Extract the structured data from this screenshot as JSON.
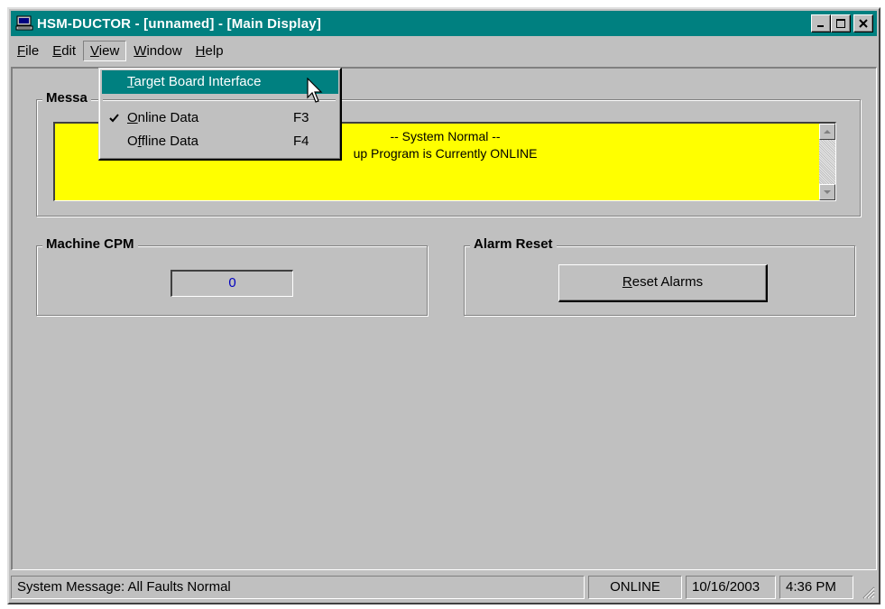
{
  "window": {
    "title": "HSM-DUCTOR - [unnamed] - [Main Display]",
    "title_buttons": [
      "minimize",
      "maximize",
      "close"
    ]
  },
  "menubar": {
    "items": [
      {
        "label": "File",
        "accel": "F",
        "rest": "ile"
      },
      {
        "label": "Edit",
        "accel": "E",
        "rest": "dit"
      },
      {
        "label": "View",
        "accel": "V",
        "rest": "iew",
        "open": true
      },
      {
        "label": "Window",
        "accel": "W",
        "rest": "indow"
      },
      {
        "label": "Help",
        "accel": "H",
        "rest": "elp"
      }
    ]
  },
  "view_menu": {
    "items": [
      {
        "label": "Target Board Interface",
        "accel": "T",
        "rest": "arget Board Interface",
        "shortcut": "",
        "checked": false,
        "highlighted": true
      },
      {
        "label": "Online Data",
        "accel": "O",
        "pre": "",
        "rest": "nline Data",
        "shortcut": "F3",
        "checked": true
      },
      {
        "label": "Offline Data",
        "accel": "f",
        "pre": "O",
        "rest": "fline Data",
        "shortcut": "F4",
        "checked": false
      }
    ]
  },
  "messages": {
    "group_label": "Messa",
    "line1": "-- System Normal --",
    "line2": "up Program is Currently ONLINE",
    "background": "#ffff00"
  },
  "machine_cpm": {
    "group_label": "Machine CPM",
    "value": "0"
  },
  "alarm_reset": {
    "group_label": "Alarm Reset",
    "button_accel": "R",
    "button_rest": "eset Alarms",
    "button_label": "Reset Alarms"
  },
  "statusbar": {
    "message": "System Message:  All Faults Normal",
    "mode": "ONLINE",
    "date": "10/16/2003",
    "time": "4:36 PM"
  },
  "colors": {
    "titlebar": "#008080",
    "face": "#c0c0c0",
    "highlight": "#008080",
    "cpm_text": "#0000c0"
  },
  "icons": {
    "app": "computer-icon",
    "cursor": "mouse-pointer-icon",
    "check": "checkmark-icon"
  }
}
